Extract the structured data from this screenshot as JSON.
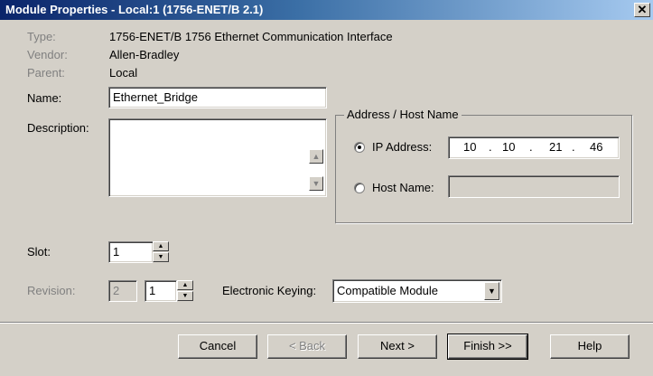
{
  "window": {
    "title": "Module Properties  - Local:1 (1756-ENET/B 2.1)",
    "close_glyph": "✕"
  },
  "info": {
    "type_label": "Type:",
    "type_value": "1756-ENET/B 1756 Ethernet Communication Interface",
    "vendor_label": "Vendor:",
    "vendor_value": "Allen-Bradley",
    "parent_label": "Parent:",
    "parent_value": "Local"
  },
  "form": {
    "name_label": "Name:",
    "name_value": "Ethernet_Bridge",
    "description_label": "Description:",
    "description_value": "",
    "slot_label": "Slot:",
    "slot_value": "1",
    "revision_label": "Revision:",
    "revision_major": "2",
    "revision_minor": "1",
    "keying_label": "Electronic Keying:",
    "keying_value": "Compatible Module"
  },
  "address_group": {
    "legend": "Address / Host Name",
    "ip_label": "IP Address:",
    "ip_octets": [
      "10",
      "10",
      "21",
      "46"
    ],
    "ip_dot": ".",
    "host_label": "Host Name:",
    "host_value": "",
    "selected": "ip"
  },
  "buttons": {
    "cancel": "Cancel",
    "back": "< Back",
    "next": "Next >",
    "finish": "Finish >>",
    "help": "Help"
  },
  "icons": {
    "scroll_up": "▲",
    "scroll_down": "▼",
    "spin_up": "▲",
    "spin_down": "▼",
    "dropdown": "▼"
  },
  "colors": {
    "titlebar_start": "#0a246a",
    "titlebar_end": "#a6caf0",
    "dialog_bg": "#d4d0c8"
  }
}
